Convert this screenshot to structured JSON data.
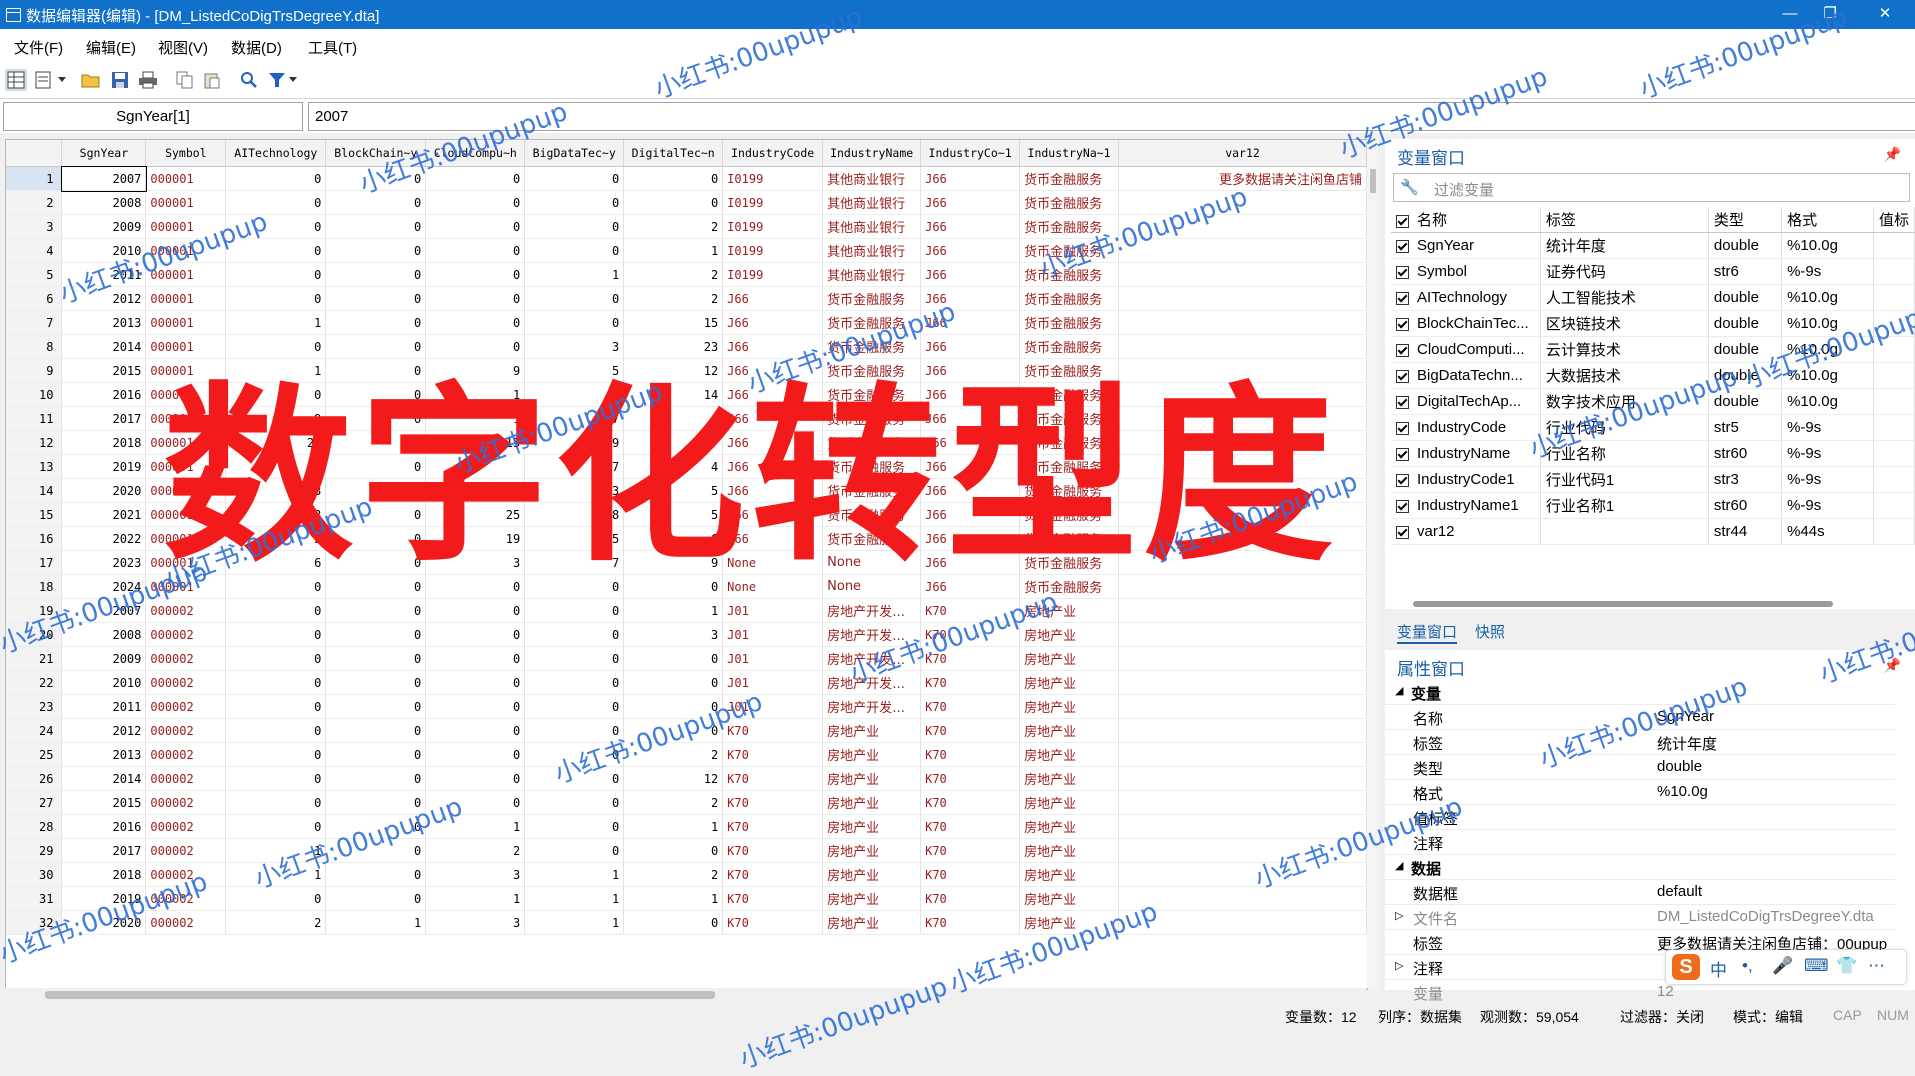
{
  "window": {
    "title": "数据编辑器(编辑) - [DM_ListedCoDigTrsDegreeY.dta]",
    "minimize_glyph": "—",
    "restore_glyph": "❐",
    "close_glyph": "✕"
  },
  "menu": [
    "文件(F)",
    "编辑(E)",
    "视图(V)",
    "数据(D)",
    "工具(T)"
  ],
  "toolbar_icons": [
    "data-editor-edit-icon",
    "data-editor-browse-icon",
    "open-folder-icon",
    "save-icon",
    "print-icon",
    "copy-icon",
    "paste-icon",
    "search-icon",
    "filter-icon"
  ],
  "cmdbar": {
    "varname": "SgnYear[1]",
    "value": "2007"
  },
  "grid": {
    "columns": [
      "SgnYear",
      "Symbol",
      "AITechnology",
      "BlockChain~y",
      "CloudCompu~h",
      "BigDataTec~y",
      "DigitalTec~n",
      "IndustryCode",
      "IndustryName",
      "IndustryCo~1",
      "IndustryNa~1",
      "var12"
    ],
    "rows": [
      [
        "1",
        "2007",
        "000001",
        "0",
        "0",
        "0",
        "0",
        "0",
        "I0199",
        "其他商业银行",
        "J66",
        "货币金融服务",
        "更多数据请关注闲鱼店铺"
      ],
      [
        "2",
        "2008",
        "000001",
        "0",
        "0",
        "0",
        "0",
        "0",
        "I0199",
        "其他商业银行",
        "J66",
        "货币金融服务",
        ""
      ],
      [
        "3",
        "2009",
        "000001",
        "0",
        "0",
        "0",
        "0",
        "2",
        "I0199",
        "其他商业银行",
        "J66",
        "货币金融服务",
        ""
      ],
      [
        "4",
        "2010",
        "000001",
        "0",
        "0",
        "0",
        "0",
        "1",
        "I0199",
        "其他商业银行",
        "J66",
        "货币金融服务",
        ""
      ],
      [
        "5",
        "2011",
        "000001",
        "0",
        "0",
        "0",
        "1",
        "2",
        "I0199",
        "其他商业银行",
        "J66",
        "货币金融服务",
        ""
      ],
      [
        "6",
        "2012",
        "000001",
        "0",
        "0",
        "0",
        "0",
        "2",
        "J66",
        "货币金融服务",
        "J66",
        "货币金融服务",
        ""
      ],
      [
        "7",
        "2013",
        "000001",
        "1",
        "0",
        "0",
        "0",
        "15",
        "J66",
        "货币金融服务",
        "J66",
        "货币金融服务",
        ""
      ],
      [
        "8",
        "2014",
        "000001",
        "0",
        "0",
        "0",
        "3",
        "23",
        "J66",
        "货币金融服务",
        "J66",
        "货币金融服务",
        ""
      ],
      [
        "9",
        "2015",
        "000001",
        "1",
        "0",
        "9",
        "5",
        "12",
        "J66",
        "货币金融服务",
        "J66",
        "货币金融服务",
        ""
      ],
      [
        "10",
        "2016",
        "000001",
        "0",
        "0",
        "1",
        "7",
        "14",
        "J66",
        "货币金融服务",
        "J66",
        "货币金融服务",
        ""
      ],
      [
        "11",
        "2017",
        "000001",
        "9",
        "0",
        "1",
        "17",
        "",
        "J66",
        "货币金融服务",
        "J66",
        "货币金融服务",
        ""
      ],
      [
        "12",
        "2018",
        "000001",
        "22",
        "0",
        "15",
        "29",
        "7",
        "J66",
        "货币金融服务",
        "J66",
        "货币金融服务",
        ""
      ],
      [
        "13",
        "2019",
        "000001",
        "",
        "0",
        "",
        "27",
        "4",
        "J66",
        "货币金融服务",
        "J66",
        "货币金融服务",
        ""
      ],
      [
        "14",
        "2020",
        "000001",
        "3",
        "2",
        "20",
        "23",
        "5",
        "J66",
        "货币金融服务",
        "J66",
        "货币金融服务",
        ""
      ],
      [
        "15",
        "2021",
        "000001",
        "13",
        "0",
        "25",
        "18",
        "5",
        "J66",
        "货币金融服务",
        "J66",
        "货币金融服务",
        ""
      ],
      [
        "16",
        "2022",
        "000001",
        "3",
        "0",
        "19",
        "25",
        "6",
        "J66",
        "货币金融服务",
        "J66",
        "货币金融服务",
        ""
      ],
      [
        "17",
        "2023",
        "000001",
        "6",
        "0",
        "3",
        "7",
        "9",
        "None",
        "None",
        "J66",
        "货币金融服务",
        ""
      ],
      [
        "18",
        "2024",
        "000001",
        "0",
        "0",
        "0",
        "0",
        "0",
        "None",
        "None",
        "J66",
        "货币金融服务",
        ""
      ],
      [
        "19",
        "2007",
        "000002",
        "0",
        "0",
        "0",
        "0",
        "1",
        "J01",
        "房地产开发…",
        "K70",
        "房地产业",
        ""
      ],
      [
        "20",
        "2008",
        "000002",
        "0",
        "0",
        "0",
        "0",
        "3",
        "J01",
        "房地产开发…",
        "K70",
        "房地产业",
        ""
      ],
      [
        "21",
        "2009",
        "000002",
        "0",
        "0",
        "0",
        "0",
        "0",
        "J01",
        "房地产开发…",
        "K70",
        "房地产业",
        ""
      ],
      [
        "22",
        "2010",
        "000002",
        "0",
        "0",
        "0",
        "0",
        "0",
        "J01",
        "房地产开发…",
        "K70",
        "房地产业",
        ""
      ],
      [
        "23",
        "2011",
        "000002",
        "0",
        "0",
        "0",
        "0",
        "0",
        "J01",
        "房地产开发…",
        "K70",
        "房地产业",
        ""
      ],
      [
        "24",
        "2012",
        "000002",
        "0",
        "0",
        "0",
        "0",
        "0",
        "K70",
        "房地产业",
        "K70",
        "房地产业",
        ""
      ],
      [
        "25",
        "2013",
        "000002",
        "0",
        "0",
        "0",
        "0",
        "2",
        "K70",
        "房地产业",
        "K70",
        "房地产业",
        ""
      ],
      [
        "26",
        "2014",
        "000002",
        "0",
        "0",
        "0",
        "0",
        "12",
        "K70",
        "房地产业",
        "K70",
        "房地产业",
        ""
      ],
      [
        "27",
        "2015",
        "000002",
        "0",
        "0",
        "0",
        "0",
        "2",
        "K70",
        "房地产业",
        "K70",
        "房地产业",
        ""
      ],
      [
        "28",
        "2016",
        "000002",
        "0",
        "0",
        "1",
        "0",
        "1",
        "K70",
        "房地产业",
        "K70",
        "房地产业",
        ""
      ],
      [
        "29",
        "2017",
        "000002",
        "1",
        "0",
        "2",
        "0",
        "0",
        "K70",
        "房地产业",
        "K70",
        "房地产业",
        ""
      ],
      [
        "30",
        "2018",
        "000002",
        "1",
        "0",
        "3",
        "1",
        "2",
        "K70",
        "房地产业",
        "K70",
        "房地产业",
        ""
      ],
      [
        "31",
        "2019",
        "000002",
        "0",
        "0",
        "1",
        "1",
        "1",
        "K70",
        "房地产业",
        "K70",
        "房地产业",
        ""
      ],
      [
        "32",
        "2020",
        "000002",
        "2",
        "1",
        "3",
        "1",
        "0",
        "K70",
        "房地产业",
        "K70",
        "房地产业",
        ""
      ]
    ]
  },
  "variables_panel": {
    "title": "变量窗口",
    "filter_placeholder": "过滤变量",
    "headers": [
      "名称",
      "标签",
      "类型",
      "格式",
      "值标"
    ],
    "rows": [
      [
        "SgnYear",
        "统计年度",
        "double",
        "%10.0g"
      ],
      [
        "Symbol",
        "证券代码",
        "str6",
        "%-9s"
      ],
      [
        "AITechnology",
        "人工智能技术",
        "double",
        "%10.0g"
      ],
      [
        "BlockChainTec...",
        "区块链技术",
        "double",
        "%10.0g"
      ],
      [
        "CloudComputi...",
        "云计算技术",
        "double",
        "%10.0g"
      ],
      [
        "BigDataTechn...",
        "大数据技术",
        "double",
        "%10.0g"
      ],
      [
        "DigitalTechAp...",
        "数字技术应用",
        "double",
        "%10.0g"
      ],
      [
        "IndustryCode",
        "行业代码",
        "str5",
        "%-9s"
      ],
      [
        "IndustryName",
        "行业名称",
        "str60",
        "%-9s"
      ],
      [
        "IndustryCode1",
        "行业代码1",
        "str3",
        "%-9s"
      ],
      [
        "IndustryName1",
        "行业名称1",
        "str60",
        "%-9s"
      ],
      [
        "var12",
        "",
        "str44",
        "%44s"
      ]
    ]
  },
  "tabs": [
    "变量窗口",
    "快照"
  ],
  "properties_panel": {
    "title": "属性窗口",
    "var_group": "变量",
    "var_rows": [
      [
        "名称",
        "SgnYear"
      ],
      [
        "标签",
        "统计年度"
      ],
      [
        "类型",
        "double"
      ],
      [
        "格式",
        "%10.0g"
      ],
      [
        "值标签",
        ""
      ],
      [
        "注释",
        ""
      ]
    ],
    "data_group": "数据",
    "data_rows": [
      [
        "数据框",
        "default"
      ],
      [
        "文件名",
        "DM_ListedCoDigTrsDegreeY.dta"
      ],
      [
        "标签",
        "更多数据请关注闲鱼店铺：00upup"
      ],
      [
        "注释",
        ""
      ],
      [
        "变量",
        "12"
      ]
    ]
  },
  "status": {
    "vars": "变量数：12",
    "order": "列序：数据集",
    "obs": "观测数：59,054",
    "filter": "过滤器：关闭",
    "mode": "模式：编辑",
    "cap": "CAP",
    "num": "NUM"
  },
  "overlay_title": "数字化转型度",
  "watermark": "小红书:00upupup",
  "ime": {
    "chars": [
      "中",
      "•,",
      "🎤",
      "⌨",
      "👕",
      "⋯"
    ]
  },
  "colors": {
    "titlebar": "#1170c9",
    "overlay": "#f21a1a",
    "string_values": "#9b1c1c",
    "watermark": "#2f6fd6"
  }
}
